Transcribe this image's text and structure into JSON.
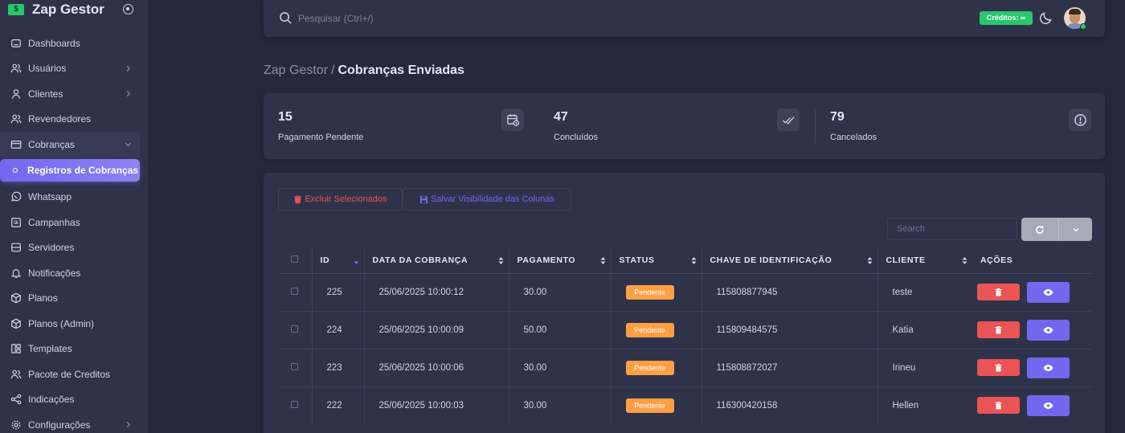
{
  "brand": {
    "name": "Zap Gestor",
    "logo_glyph": "$"
  },
  "sidebar": {
    "items": [
      {
        "label": "Dashboards",
        "icon": "home-icon"
      },
      {
        "label": "Usuários",
        "icon": "users-icon",
        "chevron": true
      },
      {
        "label": "Clientes",
        "icon": "user-icon",
        "chevron": true
      },
      {
        "label": "Revendedores",
        "icon": "users-icon"
      },
      {
        "label": "Cobranças",
        "icon": "credit-card-icon",
        "chevron": true,
        "open": true
      },
      {
        "label": "Registros de Cobranças",
        "icon": "circle-icon",
        "active": true
      },
      {
        "label": "Whatsapp",
        "icon": "whatsapp-icon"
      },
      {
        "label": "Campanhas",
        "icon": "broadcast-icon"
      },
      {
        "label": "Servidores",
        "icon": "server-icon"
      },
      {
        "label": "Notificações",
        "icon": "bell-icon"
      },
      {
        "label": "Planos",
        "icon": "package-icon"
      },
      {
        "label": "Planos (Admin)",
        "icon": "package-icon"
      },
      {
        "label": "Templates",
        "icon": "layout-icon"
      },
      {
        "label": "Pacote de Creditos",
        "icon": "users-icon"
      },
      {
        "label": "Indicações",
        "icon": "share-icon"
      },
      {
        "label": "Configurações",
        "icon": "gear-icon",
        "chevron": true
      }
    ]
  },
  "topbar": {
    "search_placeholder": "Pesquisar (Ctrl+/)",
    "credits_label": "Créditos: ∞"
  },
  "breadcrumb": {
    "root": "Zap Gestor",
    "separator": "/",
    "current": "Cobranças Enviadas"
  },
  "stats": [
    {
      "value": "15",
      "label": "Pagamento Pendente",
      "icon": "calendar-clock-icon"
    },
    {
      "value": "47",
      "label": "Concluídos",
      "icon": "double-check-icon"
    },
    {
      "value": "79",
      "label": "Cancelados",
      "icon": "alert-circle-icon"
    }
  ],
  "toolbar": {
    "delete_selected": "Excluir Selecionados",
    "save_columns": "Salvar Visibilidade das Colunas",
    "search_placeholder": "Search"
  },
  "table": {
    "columns": [
      "ID",
      "Data da Cobrança",
      "Pagamento",
      "Status",
      "Chave de Identificação",
      "Cliente",
      "Ações"
    ],
    "rows": [
      {
        "id": "225",
        "date": "25/06/2025 10:00:12",
        "payment": "30.00",
        "status": "Pendente",
        "key": "115808877945",
        "client": "teste"
      },
      {
        "id": "224",
        "date": "25/06/2025 10:00:09",
        "payment": "50.00",
        "status": "Pendente",
        "key": "115809484575",
        "client": "Katia"
      },
      {
        "id": "223",
        "date": "25/06/2025 10:00:06",
        "payment": "30.00",
        "status": "Pendente",
        "key": "115808872027",
        "client": "Irineu"
      },
      {
        "id": "222",
        "date": "25/06/2025 10:00:03",
        "payment": "30.00",
        "status": "Pendente",
        "key": "116300420158",
        "client": "Hellen"
      }
    ]
  },
  "colors": {
    "accent": "#7367f0",
    "success": "#28c76f",
    "danger": "#ea5455",
    "warning": "#ff9f43"
  }
}
